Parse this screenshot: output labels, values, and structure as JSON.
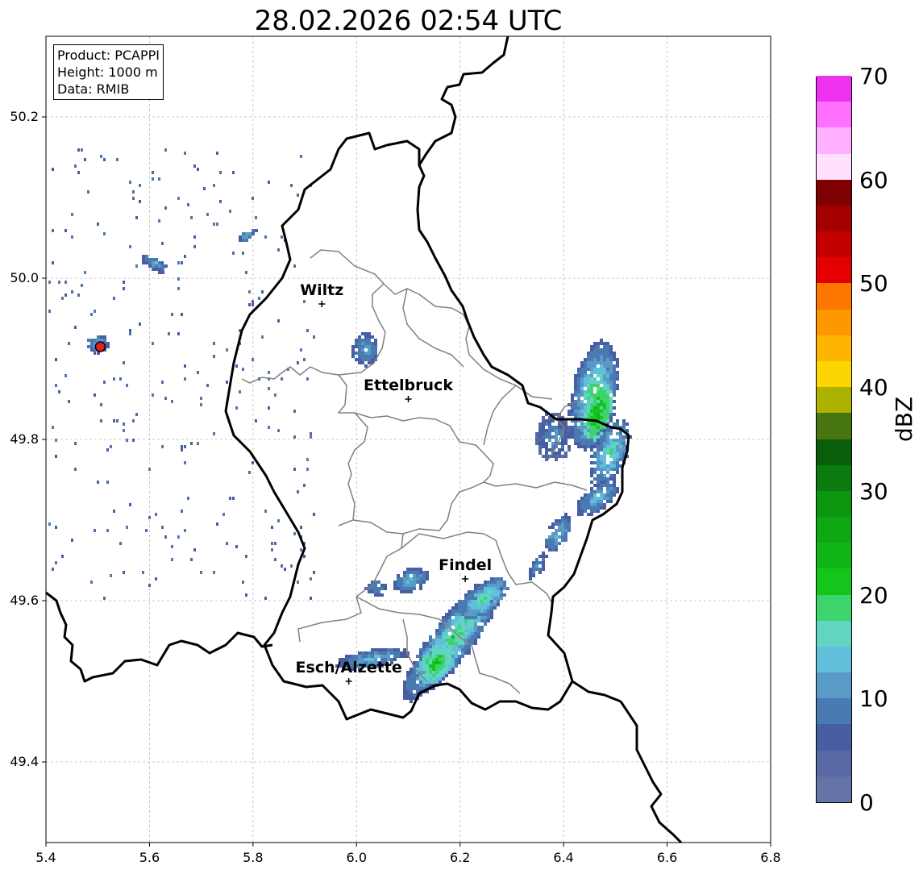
{
  "title": "28.02.2026 02:54 UTC",
  "info": {
    "product": "Product: PCAPPI",
    "height": "Height: 1000 m",
    "data": "Data: RMIB"
  },
  "cities": [
    {
      "name": "Wiltz",
      "lon": 5.933,
      "lat": 49.968
    },
    {
      "name": "Ettelbruck",
      "lon": 6.1,
      "lat": 49.85
    },
    {
      "name": "Findel",
      "lon": 6.21,
      "lat": 49.627
    },
    {
      "name": "Esch/Alzette",
      "lon": 5.985,
      "lat": 49.5
    }
  ],
  "radar_site": {
    "lon": 5.505,
    "lat": 49.915,
    "color": "#e02020"
  },
  "axes": {
    "xlim": [
      5.4,
      6.8
    ],
    "ylim": [
      49.3,
      50.3
    ],
    "xticks": [
      "5.4",
      "5.6",
      "5.8",
      "6.0",
      "6.2",
      "6.4",
      "6.6",
      "6.8"
    ],
    "yticks": [
      "49.4",
      "49.6",
      "49.8",
      "50.0",
      "50.2"
    ]
  },
  "colorbar": {
    "label": "dBZ",
    "range": [
      0,
      70
    ],
    "ticks": [
      "0",
      "10",
      "20",
      "30",
      "40",
      "50",
      "60",
      "70"
    ],
    "colors": [
      "#6473a8",
      "#5768a2",
      "#475fa2",
      "#4a7ab2",
      "#599bc6",
      "#62bfdb",
      "#5fd5c2",
      "#3ed46c",
      "#14c51b",
      "#10b616",
      "#0ea612",
      "#0c9610",
      "#0b7b10",
      "#0a5e0b",
      "#477610",
      "#adb100",
      "#fdd500",
      "#fdb500",
      "#fd9800",
      "#fd7600",
      "#e40000",
      "#c30000",
      "#a40000",
      "#7f0000",
      "#ffe1ff",
      "#ffb0ff",
      "#ff70ff",
      "#ef32ef"
    ]
  }
}
